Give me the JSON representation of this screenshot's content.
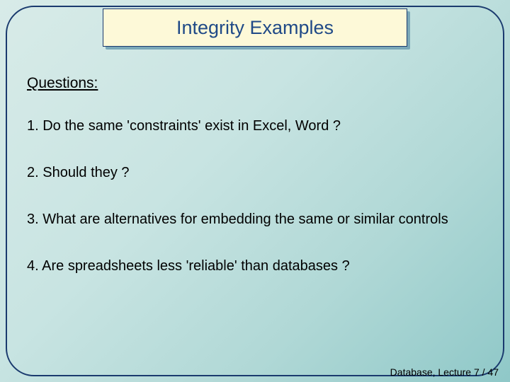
{
  "title": "Integrity Examples",
  "heading": "Questions:",
  "items": [
    "1. Do the same 'constraints' exist in Excel, Word ?",
    "2. Should they ?",
    "3. What are alternatives for embedding the same or similar controls",
    "4. Are spreadsheets less 'reliable' than databases ?"
  ],
  "footer": "Database, Lecture 7 /  47"
}
